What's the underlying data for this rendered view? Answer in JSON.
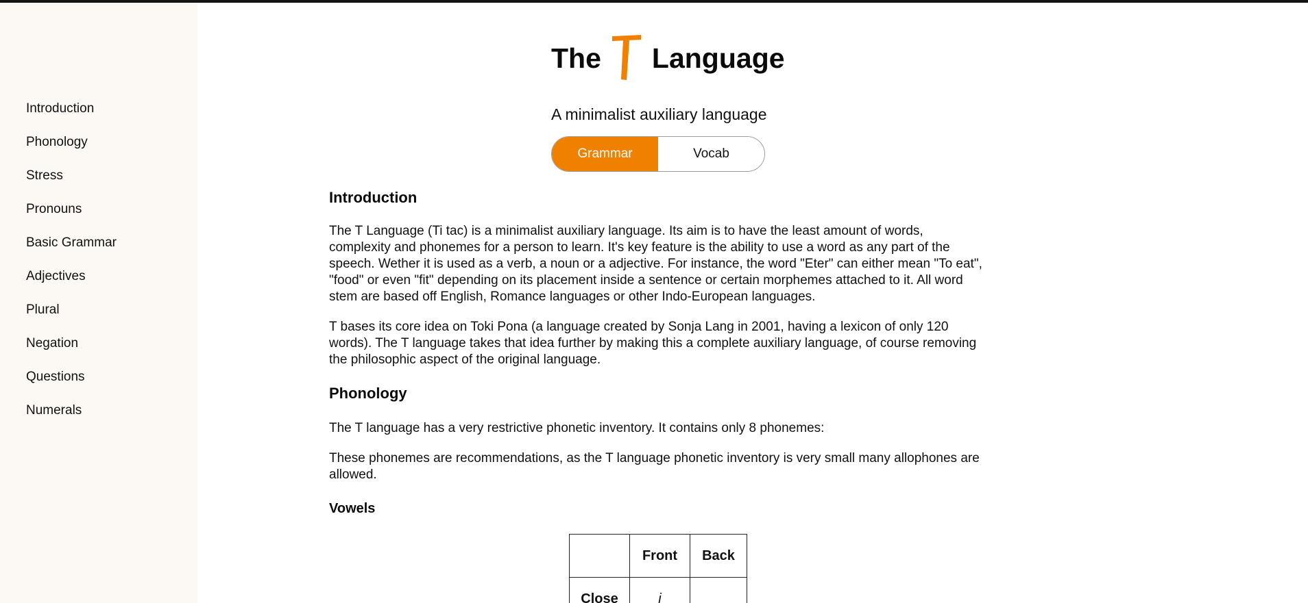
{
  "sidebar": {
    "items": [
      {
        "label": "Introduction"
      },
      {
        "label": "Phonology"
      },
      {
        "label": "Stress"
      },
      {
        "label": "Pronouns"
      },
      {
        "label": "Basic Grammar"
      },
      {
        "label": "Adjectives"
      },
      {
        "label": "Plural"
      },
      {
        "label": "Negation"
      },
      {
        "label": "Questions"
      },
      {
        "label": "Numerals"
      }
    ]
  },
  "header": {
    "title_before": "The",
    "logo_letter": "T",
    "title_after": "Language",
    "subtitle": "A minimalist auxiliary language",
    "accent_color": "#f08000"
  },
  "toggle": {
    "options": [
      {
        "label": "Grammar",
        "active": true
      },
      {
        "label": "Vocab",
        "active": false
      }
    ]
  },
  "sections": {
    "introduction": {
      "heading": "Introduction",
      "paragraphs": [
        "The T Language (Ti tac) is a minimalist auxiliary language. Its aim is to have the least amount of words, complexity and phonemes for a person to learn. It's key feature is the ability to use a word as any part of the speech. Wether it is used as a verb, a noun or a adjective. For instance, the word \"Eter\" can either mean \"To eat\", \"food\" or even \"fit\" depending on its placement inside a sentence or certain morphemes attached to it. All word stem are based off English, Romance languages or other Indo-European languages.",
        "T bases its core idea on Toki Pona (a language created by Sonja Lang in 2001, having a lexicon of only 120 words). The T language takes that idea further by making this a complete auxiliary language, of course removing the philosophic aspect of the original language."
      ]
    },
    "phonology": {
      "heading": "Phonology",
      "paragraphs": [
        "The T language has a very restrictive phonetic inventory. It contains only 8 phonemes:",
        "These phonemes are recommendations, as the T language phonetic inventory is very small many allophones are allowed."
      ]
    },
    "vowels": {
      "heading": "Vowels",
      "table": {
        "headers": [
          "",
          "Front",
          "Back"
        ],
        "rows": [
          [
            "Close",
            "i",
            ""
          ]
        ]
      }
    }
  }
}
